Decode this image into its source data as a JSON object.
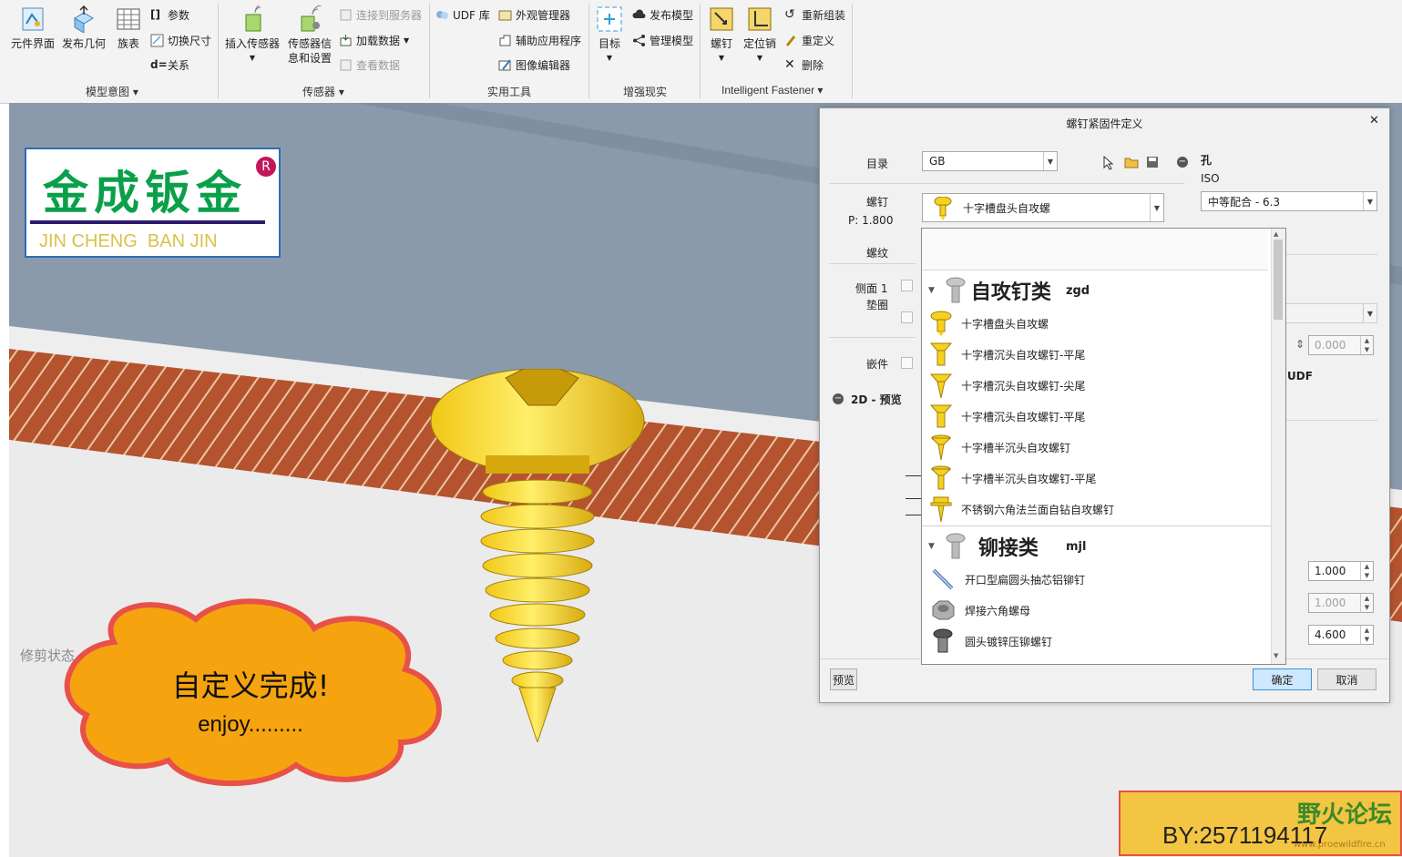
{
  "ribbon": {
    "model_intent": {
      "group_label": "模型意图",
      "buttons": [
        "元件界面",
        "发布几何",
        "族表"
      ],
      "small": [
        "参数",
        "切换尺寸",
        "关系"
      ]
    },
    "sensors": {
      "group_label": "传感器",
      "insert_sensor": "插入传感器",
      "sensor_info_line1": "传感器信",
      "sensor_info_line2": "息和设置",
      "small": [
        "连接到服务器",
        "加载数据",
        "查看数据"
      ]
    },
    "utilities": {
      "group_label": "实用工具",
      "small": [
        "UDF 库",
        "外观管理器",
        "辅助应用程序",
        "图像编辑器"
      ]
    },
    "ar": {
      "group_label": "增强现实",
      "target": "目标",
      "small": [
        "发布模型",
        "管理模型"
      ]
    },
    "fastener": {
      "group_label": "Intelligent Fastener",
      "screw": "螺钉",
      "dowel": "定位销",
      "small": [
        "重新组装",
        "重定义",
        "删除"
      ]
    }
  },
  "logo": {
    "cn": "金成钣金",
    "en": "JIN CHENG  BAN JIN",
    "mark": "R"
  },
  "viewport": {
    "trim_status": "修剪状态"
  },
  "bubble": {
    "line1": "自定义完成!",
    "line2": "enjoy........."
  },
  "watermark": {
    "by": "BY:2571194117",
    "forum": "野火论坛",
    "url": "www.proewildfire.cn"
  },
  "dialog": {
    "title": "螺钉紧固件定义",
    "catalog_label": "目录",
    "catalog_value": "GB",
    "screw_label": "螺钉",
    "screw_pitch": "P: 1.800",
    "screw_value": "十字槽盘头自攻螺",
    "thread_label": "螺纹",
    "side1_label": "侧面 1",
    "washer_label": "垫圈",
    "insert_label": "嵌件",
    "preview2d_label": "2D - 预览",
    "hole_label": "孔",
    "iso_label": "ISO",
    "fit_value": "中等配合 - 6.3",
    "depth_value": "0.000",
    "udf_label": "UDF",
    "values": [
      "1.000",
      "1.000",
      "4.600"
    ],
    "preview_button": "预览",
    "ok_button": "确定",
    "cancel_button": "取消"
  },
  "dropdown": {
    "groups": [
      {
        "title": "自攻钉类",
        "code": "zgd",
        "items": [
          "十字槽盘头自攻螺",
          "十字槽沉头自攻螺钉-平尾",
          "十字槽沉头自攻螺钉-尖尾",
          "十字槽沉头自攻螺钉-平尾",
          "十字槽半沉头自攻螺钉",
          "十字槽半沉头自攻螺钉-平尾",
          "不锈钢六角法兰面自钻自攻螺钉"
        ]
      },
      {
        "title": "铆接类",
        "code": "mjl",
        "items": [
          "开口型扁圆头抽芯铝铆钉",
          "焊接六角螺母",
          "圆头镀锌压铆螺钉"
        ]
      }
    ]
  },
  "colors": {
    "accent": "#cde8ff",
    "screw_yellow": "#f5d21f",
    "section_red": "#b5532e",
    "logo_green": "#0aa04a",
    "bubble_orange": "#f5a30f"
  }
}
